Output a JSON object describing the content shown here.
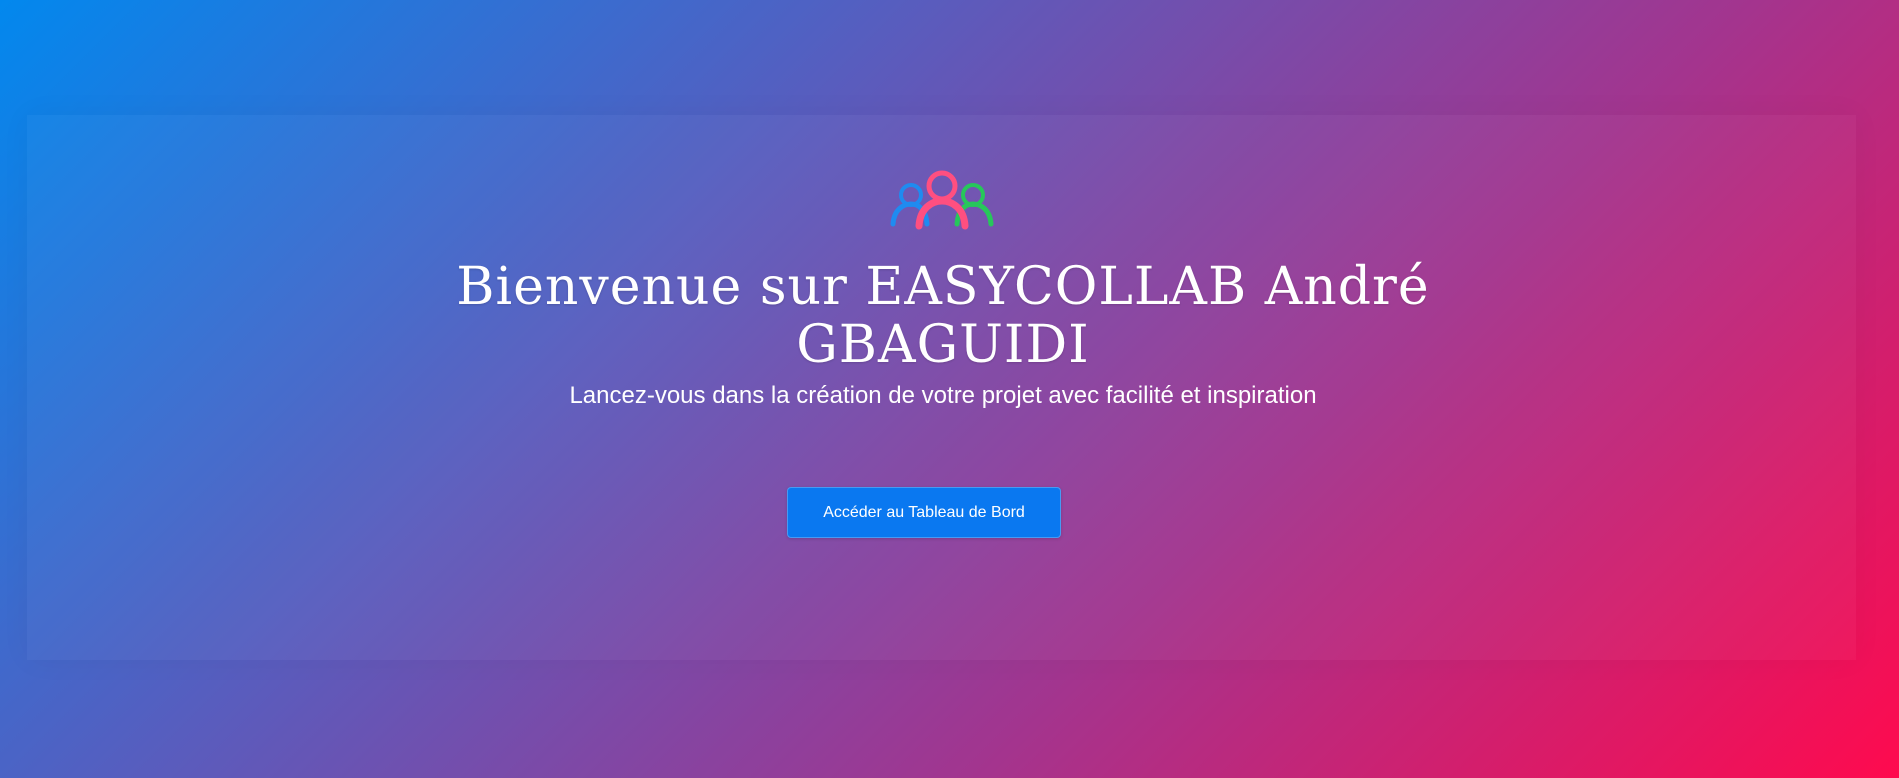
{
  "hero": {
    "logo_icon": "team-collaboration-icon",
    "title": "Bienvenue sur EASYCOLLAB André GBAGUIDI",
    "subtitle": "Lancez-vous dans la création de votre projet avec facilité et inspiration",
    "cta_label": "Accéder au Tableau de Bord"
  },
  "colors": {
    "gradient_start": "#0288ee",
    "gradient_end": "#ff0a4e",
    "button": "#0a78f0",
    "logo_blue": "#1f8bf0",
    "logo_pink": "#ff4f80",
    "logo_green": "#27c75b"
  }
}
